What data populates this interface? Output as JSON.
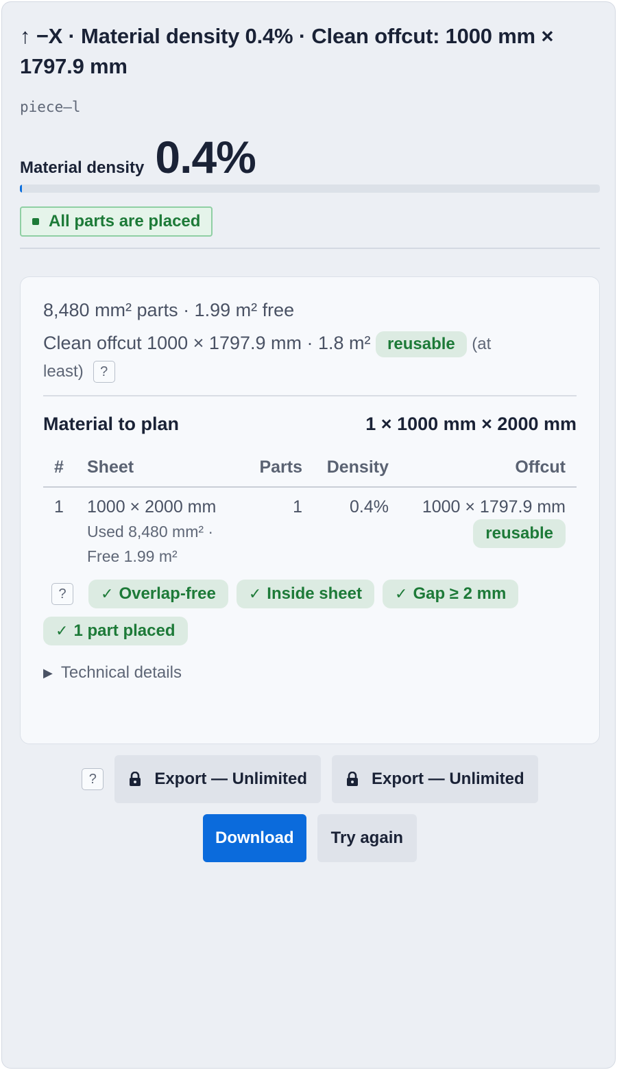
{
  "header": {
    "title": "↑ −X · Material density 0.4% · Clean offcut: 1000 mm × 1797.9 mm",
    "piece_id": "piece–l",
    "density_label": "Material density",
    "density_value": "0.4%",
    "density_fraction": 0.004,
    "status": "All parts are placed"
  },
  "summary": {
    "parts_line": "8,480 mm² parts · 1.99 m² free",
    "offcut_text": "Clean offcut 1000 × 1797.9 mm · 1.8 m²",
    "offcut_badge": "reusable",
    "at_label": "(at",
    "least_label": "least)",
    "help": "?"
  },
  "material": {
    "label": "Material to plan",
    "value": "1 × 1000 mm × 2000 mm"
  },
  "table": {
    "headers": [
      "#",
      "Sheet",
      "Parts",
      "Density",
      "Offcut"
    ],
    "rows": [
      {
        "index": "1",
        "sheet": "1000 × 2000 mm",
        "used": "Used 8,480 mm² ·",
        "free": "Free 1.99 m²",
        "parts": "1",
        "density": "0.4%",
        "offcut": "1000 × 1797.9 mm",
        "offcut_badge": "reusable"
      }
    ]
  },
  "checks": {
    "help": "?",
    "items": [
      "Overlap-free",
      "Inside sheet",
      "Gap ≥ 2 mm",
      "1 part placed"
    ]
  },
  "technical_details": "Technical details",
  "actions": {
    "help": "?",
    "export1": "Export — Unlimited",
    "export2": "Export — Unlimited",
    "download": "Download",
    "try_again": "Try again"
  },
  "colors": {
    "accent": "#0b6bdc",
    "success": "#1d7a38",
    "success_bg": "#dcebe2"
  }
}
